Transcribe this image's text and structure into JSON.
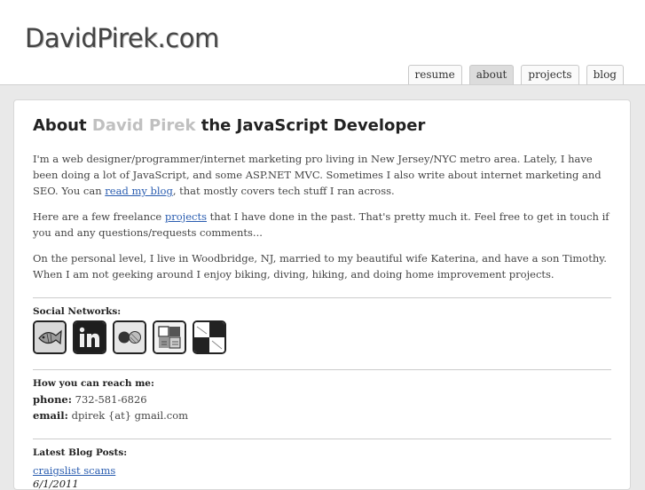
{
  "site": {
    "logo": "DavidPirek.com"
  },
  "nav": {
    "items": [
      {
        "label": "resume"
      },
      {
        "label": "about"
      },
      {
        "label": "projects"
      },
      {
        "label": "blog"
      }
    ]
  },
  "heading": {
    "prefix": "About",
    "name": "David Pirek",
    "suffix": "the JavaScript Developer"
  },
  "intro": {
    "p1_text": "I'm a web designer/programmer/internet marketing pro living in New Jersey/NYC metro area. Lately, I have been doing a lot of JavaScript, and some ASP.NET MVC. Sometimes I also write about internet marketing and SEO. You can ",
    "p1_link": "read my blog",
    "p1_end": ", that mostly covers tech stuff I ran across.",
    "p2_text": "Here are a few freelance ",
    "p2_link": "projects",
    "p2_end": " that I have done in the past. That's pretty much it. Feel free to get in touch if you and any questions/requests comments...",
    "p3": "On the personal level, I live in Woodbridge, NJ, married to my beautiful wife Katerina, and have a son Timothy. When I am not geeking around I enjoy biking, diving, hiking, and doing home improvement projects."
  },
  "social": {
    "title": "Social Networks:",
    "icons": [
      "fish-icon",
      "linkedin-icon",
      "flickr-icon",
      "delicious-icon",
      "blocks-icon"
    ]
  },
  "contact": {
    "title": "How you can reach me:",
    "phone_label": "phone:",
    "phone": "732-581-6826",
    "email_label": "email:",
    "email": "dpirek {at} gmail.com"
  },
  "blog": {
    "title": "Latest Blog Posts:",
    "posts": [
      {
        "title": "craigslist scams",
        "date": "6/1/2011"
      }
    ]
  }
}
